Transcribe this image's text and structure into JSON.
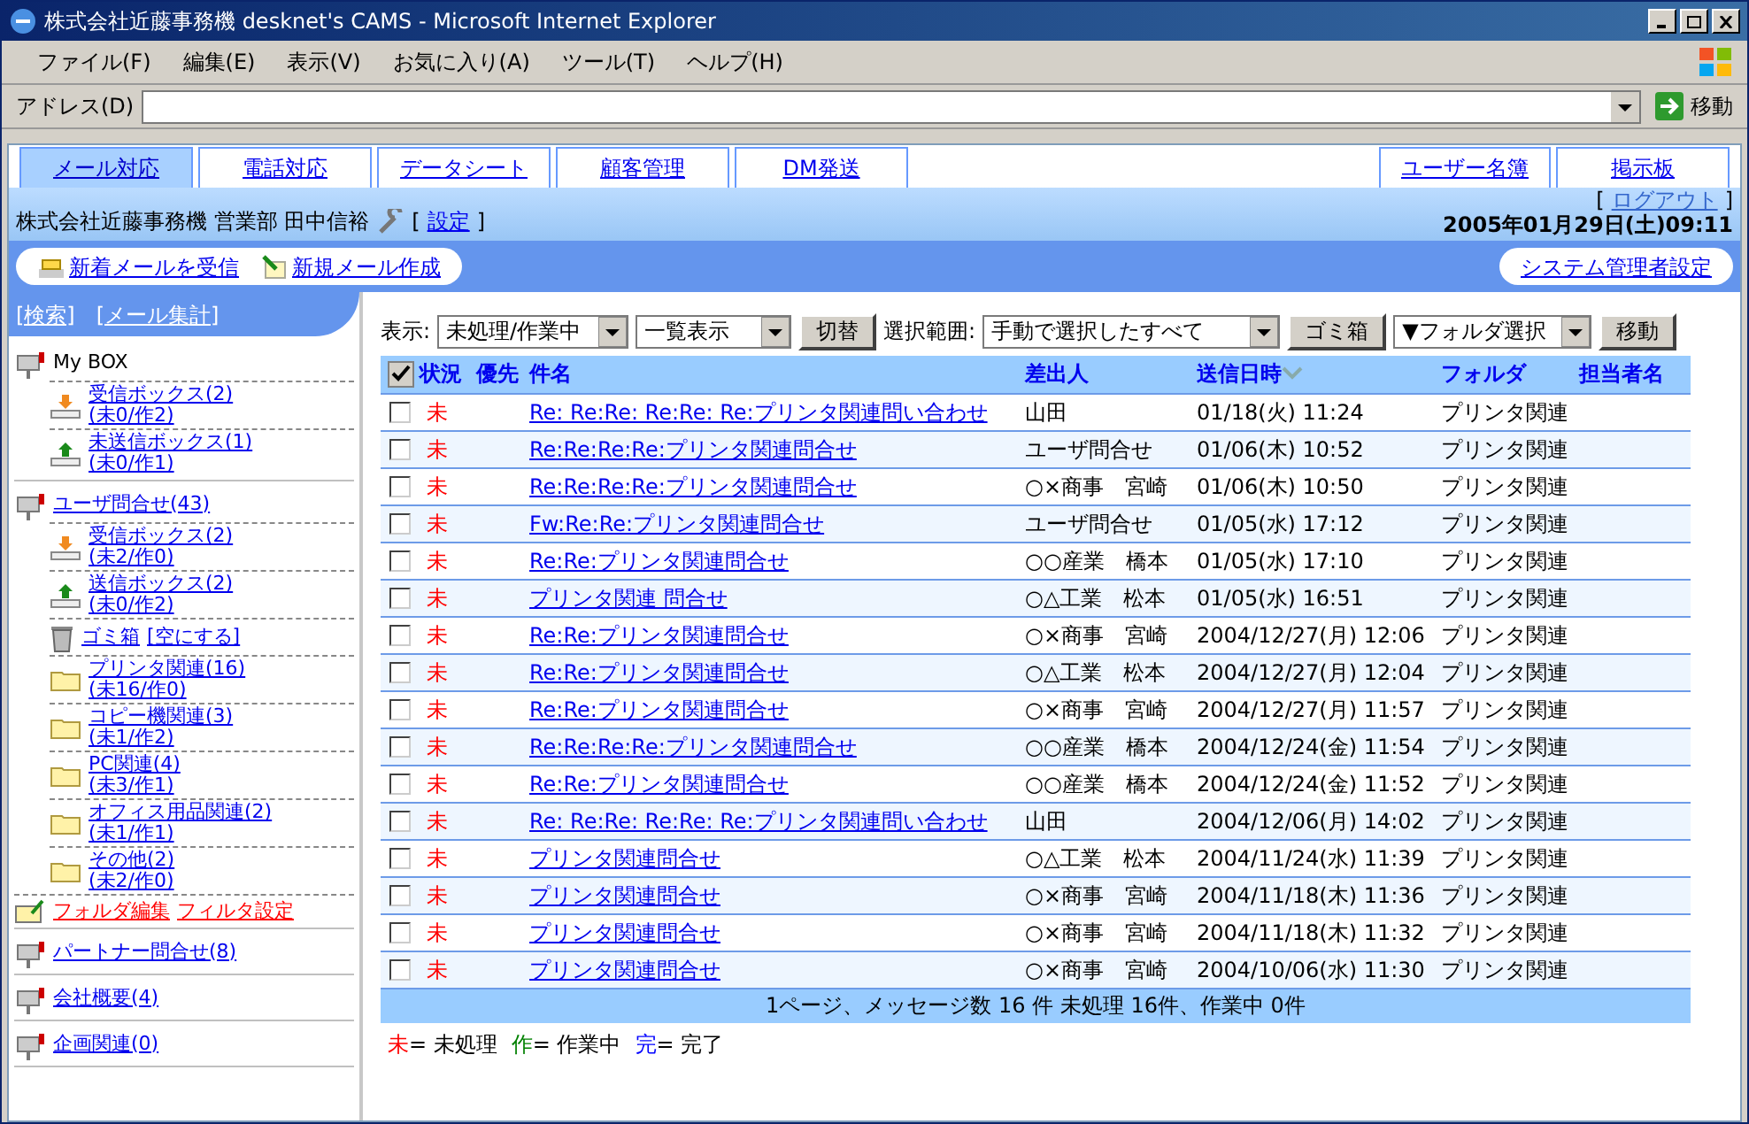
{
  "window": {
    "title": "株式会社近藤事務機 desknet's CAMS - Microsoft Internet Explorer"
  },
  "menu_bar": [
    "ファイル(F)",
    "編集(E)",
    "表示(V)",
    "お気に入り(A)",
    "ツール(T)",
    "ヘルプ(H)"
  ],
  "address_bar": {
    "label": "アドレス(D)",
    "go_button": "移動"
  },
  "tabs_left": [
    {
      "label": "メール対応",
      "selected": true
    },
    {
      "label": "電話対応",
      "selected": false
    },
    {
      "label": "データシート",
      "selected": false
    },
    {
      "label": "顧客管理",
      "selected": false
    },
    {
      "label": "DM発送",
      "selected": false
    }
  ],
  "tabs_right": [
    {
      "label": "ユーザー名簿",
      "selected": false
    },
    {
      "label": "掲示板",
      "selected": false
    }
  ],
  "header": {
    "user": "株式会社近藤事務機 営業部 田中信裕",
    "settings": {
      "open": "[",
      "link": "設定",
      "close": "]"
    },
    "logout": {
      "open": "[",
      "link": "ログアウト",
      "close": "]"
    },
    "datetime": "2005年01月29日(土)09:11"
  },
  "toolbar": {
    "receive_link": "新着メールを受信",
    "compose_link": "新規メール作成",
    "admin_link": "システム管理者設定"
  },
  "sidebar": {
    "links": [
      "[検索]",
      "[メール集計]"
    ],
    "boxes": [
      {
        "label": "My BOX",
        "link": false,
        "children": [
          {
            "kind": "inbox",
            "label": "受信ボックス(2)",
            "sub": "(未0/作2)"
          },
          {
            "kind": "outbox",
            "label": "未送信ボックス(1)",
            "sub": "(未0/作1)"
          }
        ]
      },
      {
        "label": "ユーザ問合せ(43)",
        "link": true,
        "children": [
          {
            "kind": "inbox",
            "label": "受信ボックス(2)",
            "sub": "(未2/作0)"
          },
          {
            "kind": "outbox",
            "label": "送信ボックス(2)",
            "sub": "(未0/作2)"
          },
          {
            "kind": "trash",
            "label": "ゴミ箱",
            "action": "[空にする]"
          },
          {
            "kind": "folder",
            "label": "プリンタ関連(16)",
            "sub": "(未16/作0)"
          },
          {
            "kind": "folder",
            "label": "コピー機関連(3)",
            "sub": "(未1/作2)"
          },
          {
            "kind": "folder",
            "label": "PC関連(4)",
            "sub": "(未3/作1)"
          },
          {
            "kind": "folder",
            "label": "オフィス用品関連(2)",
            "sub": "(未1/作1)"
          },
          {
            "kind": "folder",
            "label": "その他(2)",
            "sub": "(未2/作0)"
          }
        ],
        "actions": [
          "フォルダ編集",
          "フィルタ設定"
        ]
      },
      {
        "label": "パートナー問合せ(8)",
        "link": true
      },
      {
        "label": "会社概要(4)",
        "link": true
      },
      {
        "label": "企画関連(0)",
        "link": true
      }
    ]
  },
  "filter_bar": {
    "display_label": "表示:",
    "status_select": "未処理/作業中",
    "view_select": "一覧表示",
    "switch_button": "切替",
    "range_label": "選択範囲:",
    "range_select": "手動で選択したすべて",
    "trash_button": "ゴミ箱",
    "folder_select": "▼フォルダ選択",
    "move_button": "移動"
  },
  "table": {
    "select_all_checked": true,
    "columns": [
      {
        "label": "状況",
        "sorted": false
      },
      {
        "label": "優先",
        "sorted": false
      },
      {
        "label": "件名",
        "sorted": false
      },
      {
        "label": "差出人",
        "sorted": false
      },
      {
        "label": "送信日時",
        "sorted": true
      },
      {
        "label": "フォルダ",
        "sorted": false
      },
      {
        "label": "担当者名",
        "sorted": false
      }
    ],
    "rows": [
      {
        "checked": false,
        "status": "未",
        "subject": "Re: Re:Re: Re:Re: Re:プリンタ関連問い合わせ",
        "sender": "山田",
        "date": "01/18(火) 11:24",
        "folder": "プリンタ関連"
      },
      {
        "checked": false,
        "status": "未",
        "subject": "Re:Re:Re:Re:プリンタ関連問合せ",
        "sender": "ユーザ問合せ",
        "date": "01/06(木) 10:52",
        "folder": "プリンタ関連"
      },
      {
        "checked": false,
        "status": "未",
        "subject": "Re:Re:Re:Re:プリンタ関連問合せ",
        "sender": "○×商事　宮崎",
        "date": "01/06(木) 10:50",
        "folder": "プリンタ関連"
      },
      {
        "checked": false,
        "status": "未",
        "subject": "Fw:Re:Re:プリンタ関連問合せ",
        "sender": "ユーザ問合せ",
        "date": "01/05(水) 17:12",
        "folder": "プリンタ関連"
      },
      {
        "checked": false,
        "status": "未",
        "subject": "Re:Re:プリンタ関連問合せ",
        "sender": "○○産業　橋本",
        "date": "01/05(水) 17:10",
        "folder": "プリンタ関連"
      },
      {
        "checked": false,
        "status": "未",
        "subject": "プリンタ関連 問合せ",
        "sender": "○△工業　松本",
        "date": "01/05(水) 16:51",
        "folder": "プリンタ関連"
      },
      {
        "checked": false,
        "status": "未",
        "subject": "Re:Re:プリンタ関連問合せ",
        "sender": "○×商事　宮崎",
        "date": "2004/12/27(月) 12:06",
        "folder": "プリンタ関連"
      },
      {
        "checked": false,
        "status": "未",
        "subject": "Re:Re:プリンタ関連問合せ",
        "sender": "○△工業　松本",
        "date": "2004/12/27(月) 12:04",
        "folder": "プリンタ関連"
      },
      {
        "checked": false,
        "status": "未",
        "subject": "Re:Re:プリンタ関連問合せ",
        "sender": "○×商事　宮崎",
        "date": "2004/12/27(月) 11:57",
        "folder": "プリンタ関連"
      },
      {
        "checked": false,
        "status": "未",
        "subject": "Re:Re:Re:Re:プリンタ関連問合せ",
        "sender": "○○産業　橋本",
        "date": "2004/12/24(金) 11:54",
        "folder": "プリンタ関連"
      },
      {
        "checked": false,
        "status": "未",
        "subject": "Re:Re:プリンタ関連問合せ",
        "sender": "○○産業　橋本",
        "date": "2004/12/24(金) 11:52",
        "folder": "プリンタ関連"
      },
      {
        "checked": false,
        "status": "未",
        "subject": "Re: Re:Re: Re:Re: Re:プリンタ関連問い合わせ",
        "sender": "山田",
        "date": "2004/12/06(月) 14:02",
        "folder": "プリンタ関連"
      },
      {
        "checked": false,
        "status": "未",
        "subject": "プリンタ関連問合せ",
        "sender": "○△工業　松本",
        "date": "2004/11/24(水) 11:39",
        "folder": "プリンタ関連"
      },
      {
        "checked": false,
        "status": "未",
        "subject": "プリンタ関連問合せ",
        "sender": "○×商事　宮崎",
        "date": "2004/11/18(木) 11:36",
        "folder": "プリンタ関連"
      },
      {
        "checked": false,
        "status": "未",
        "subject": "プリンタ関連問合せ",
        "sender": "○×商事　宮崎",
        "date": "2004/11/18(木) 11:32",
        "folder": "プリンタ関連"
      },
      {
        "checked": false,
        "status": "未",
        "subject": "プリンタ関連問合せ",
        "sender": "○×商事　宮崎",
        "date": "2004/10/06(水) 11:30",
        "folder": "プリンタ関連"
      }
    ],
    "summary": "1ページ、メッセージ数 16 件 未処理 16件、作業中 0件"
  },
  "legend": [
    {
      "mark": "未",
      "text": "= 未処理",
      "color": "#ff0000"
    },
    {
      "mark": "作",
      "text": "= 作業中",
      "color": "#008000"
    },
    {
      "mark": "完",
      "text": "= 完了",
      "color": "#0000ff"
    }
  ]
}
